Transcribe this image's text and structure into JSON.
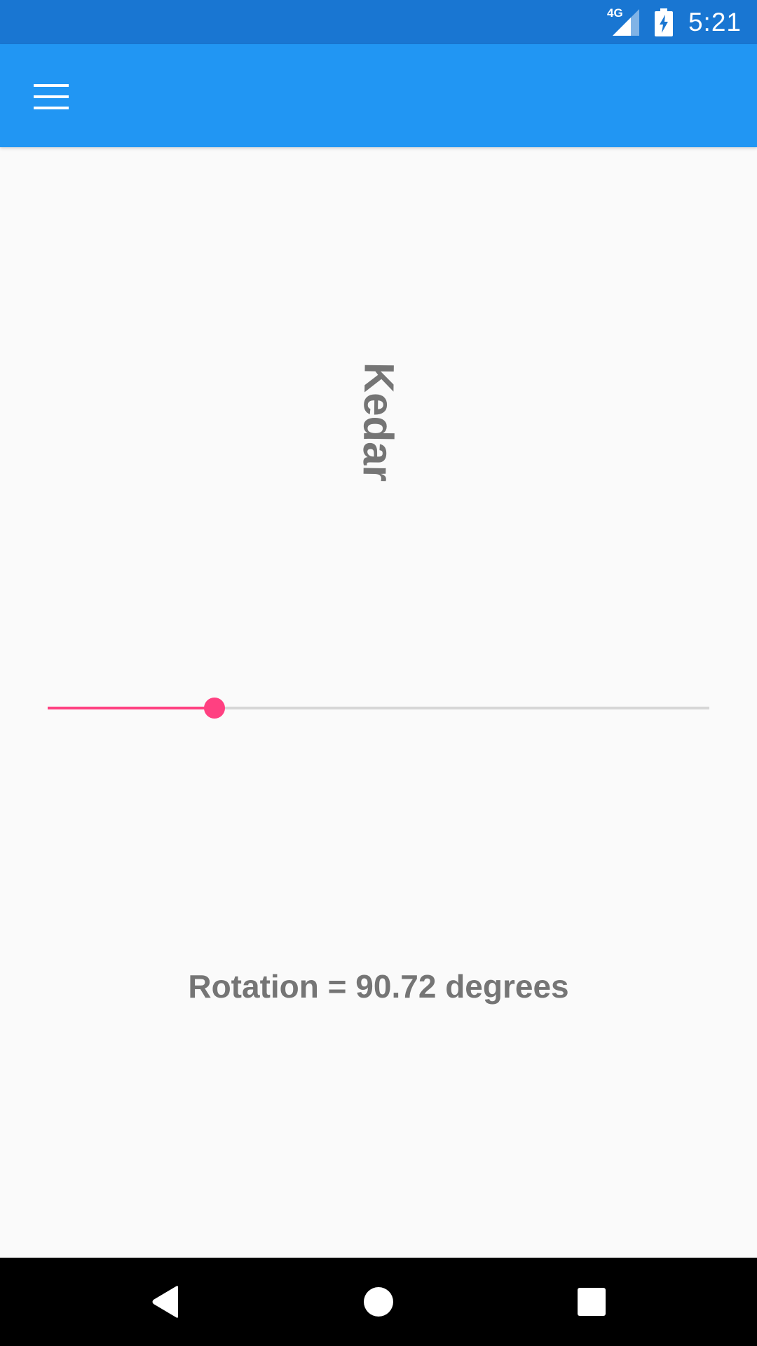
{
  "status_bar": {
    "network_label": "4G",
    "time": "5:21",
    "icons": [
      "signal-icon",
      "battery-charging-icon"
    ]
  },
  "app_bar": {
    "menu_icon": "hamburger-menu-icon",
    "color": "#2196f3"
  },
  "rotated_label": {
    "text": "Kedar"
  },
  "slider": {
    "value_fraction": 0.252,
    "accent_color": "#ff4081",
    "track_color": "#d6d6d6"
  },
  "rotation_readout": {
    "text": "Rotation = 90.72 degrees"
  },
  "nav_bar": {
    "icons": [
      "back-icon",
      "home-icon",
      "recents-icon"
    ]
  }
}
